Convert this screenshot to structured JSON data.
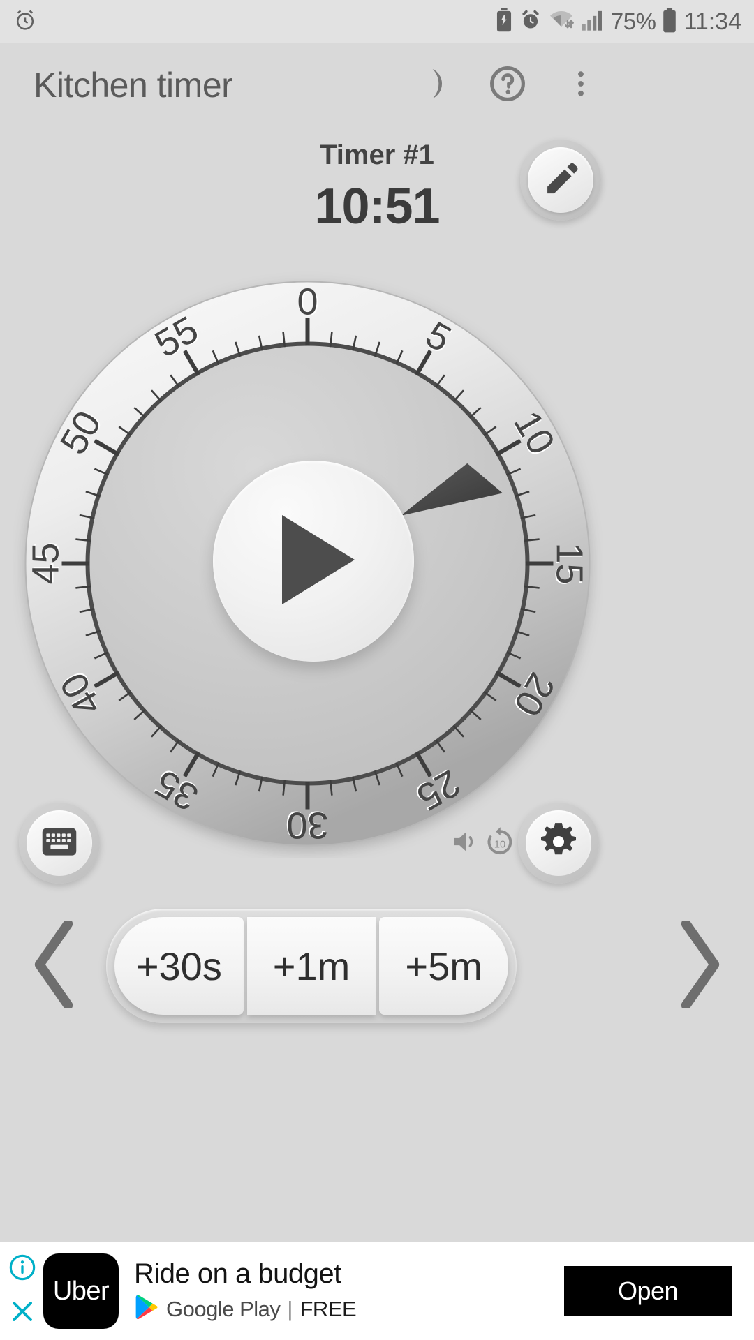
{
  "status_bar": {
    "left_icons": [
      "alarm-clock-icon"
    ],
    "right_icons": [
      "battery-saver-icon",
      "alarm-icon",
      "wifi-icon",
      "signal-icon"
    ],
    "battery_percent": "75%",
    "clock": "11:34"
  },
  "app_bar": {
    "title": "Kitchen timer",
    "actions": [
      {
        "name": "night-mode",
        "icon": "moon-icon"
      },
      {
        "name": "help",
        "icon": "question-mark-icon"
      },
      {
        "name": "overflow-menu",
        "icon": "more-vertical-icon"
      }
    ]
  },
  "timer": {
    "name": "Timer #1",
    "remaining": "10:51",
    "edit_icon": "pencil-icon",
    "play_icon": "play-icon"
  },
  "dial": {
    "labels": [
      "0",
      "5",
      "10",
      "15",
      "20",
      "25",
      "30",
      "35",
      "40",
      "45",
      "50",
      "55"
    ],
    "max_minutes": 60,
    "major_tick_every": 5,
    "minor_ticks": 60,
    "hand_minutes": 10.85
  },
  "controls": {
    "keyboard_icon": "keyboard-icon",
    "settings_icon": "gear-icon",
    "volume_icon": "volume-on-icon",
    "rewind_icon": "rewind-10-icon",
    "rewind_label": "10"
  },
  "quick_add": {
    "prev_icon": "chevron-left-icon",
    "next_icon": "chevron-right-icon",
    "buttons": [
      "+30s",
      "+1m",
      "+5m"
    ]
  },
  "ad": {
    "info_icon": "info-icon",
    "close_icon": "close-icon",
    "logo_text": "Uber",
    "headline": "Ride on a budget",
    "store_icon": "google-play-icon",
    "store_name": "Google Play",
    "separator": "|",
    "price": "FREE",
    "cta_label": "Open",
    "accent_color": "#00b0c8"
  },
  "colors": {
    "page_background": "#d9d9d9",
    "status_background": "#e2e2e2",
    "text_primary": "#3b3b3b",
    "text_secondary": "#5a5a5a",
    "dial_face": "#c9c9c9",
    "dial_ring": "#eeeeee",
    "hand": "#4a4a4a"
  }
}
